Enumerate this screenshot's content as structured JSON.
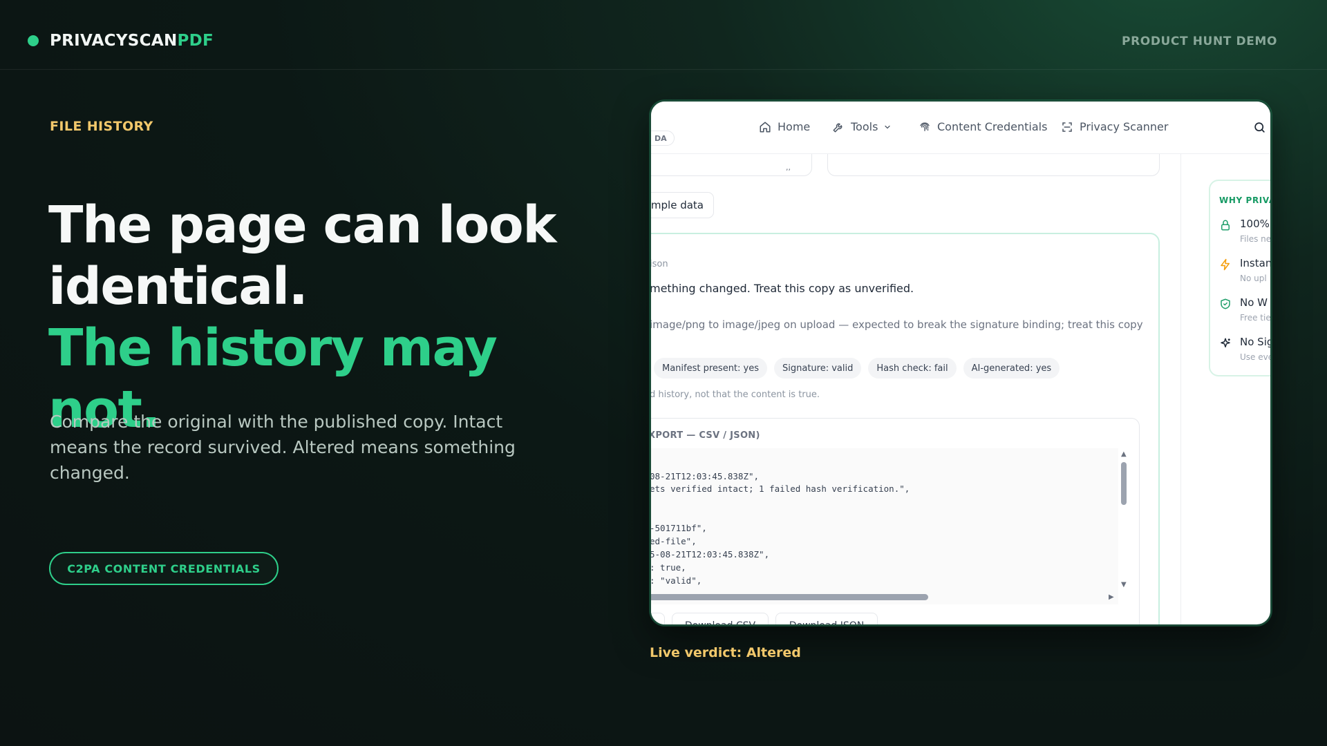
{
  "brand": {
    "name": "PRIVACYSCAN",
    "accent": "PDF"
  },
  "header": {
    "demo_label": "PRODUCT HUNT DEMO"
  },
  "hero": {
    "eyebrow": "FILE HISTORY",
    "headline_line1": "The page can look",
    "headline_line2": "identical.",
    "headline_line3": "The history may not.",
    "subtext": "Compare the original with the published copy. Intact means the record survived. Altered means something changed.",
    "cta_label": "C2PA CONTENT CREDENTIALS"
  },
  "mock": {
    "nav": {
      "cut_pill": "DA",
      "items": [
        "Home",
        "Tools",
        "Content Credentials",
        "Privacy Scanner"
      ]
    },
    "top_card_fragment": ",,",
    "sample_button": "mple data",
    "comparison_label": "ison",
    "summary": "mething changed. Treat this copy as unverified.",
    "detail": "image/png to image/jpeg on upload — expected to break the signature binding; treat this copy",
    "chips": [
      "Manifest present: yes",
      "Signature: valid",
      "Hash check: fail",
      "AI-generated: yes"
    ],
    "footnote": "d history, not that the content is true.",
    "export_title": "XPORT — CSV / JSON)",
    "code_lines": [
      "08-21T12:03:45.838Z\",",
      "ets verified intact; 1 failed hash verification.\",",
      "-501711bf\",",
      "ed-file\",",
      "5-08-21T12:03:45.838Z\",",
      ": true,",
      ": \"valid\","
    ],
    "download_buttons": [
      "Download CSV",
      "Download JSON"
    ],
    "side": {
      "title": "WHY PRIVA",
      "items": [
        {
          "title": "100%",
          "sub": "Files ne"
        },
        {
          "title": "Instan",
          "sub": "No upl"
        },
        {
          "title": "No W",
          "sub": "Free tie"
        },
        {
          "title": "No Sig",
          "sub": "Use eve"
        }
      ]
    }
  },
  "verdict": "Live verdict: Altered",
  "colors": {
    "accent": "#2ecf8a",
    "highlight": "#f2c86b",
    "background": "#0c1815"
  }
}
